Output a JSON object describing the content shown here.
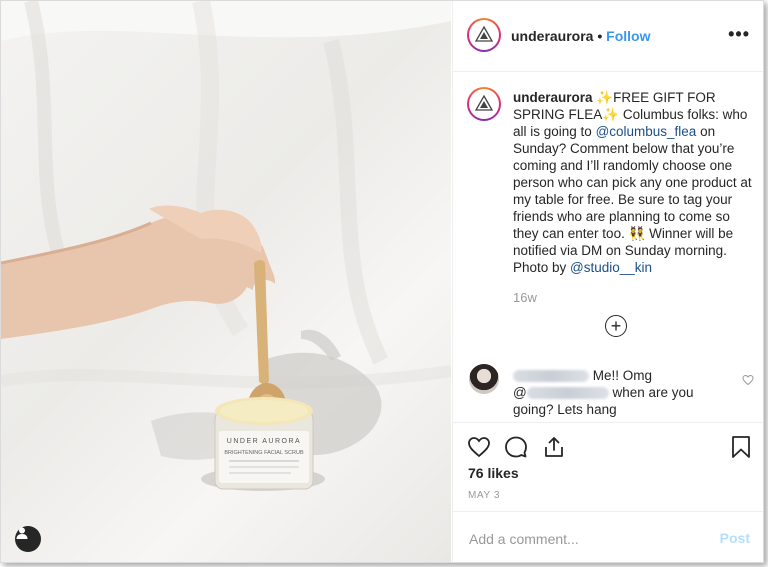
{
  "post": {
    "username": "underaurora",
    "follow_label": "Follow",
    "more_label": "•••",
    "caption_parts": {
      "lead": "✨FREE GIFT FOR SPRING FLEA✨ Columbus folks: who all is going to ",
      "mention1": "@columbus_flea",
      "middle": " on Sunday? Comment below that you’re coming and I’ll randomly choose one person who can pick any one product at my table for free. Be sure to tag your friends who are planning to come so they can enter too. 👯 Winner will be notified via DM on Sunday morning. Photo by ",
      "mention2": "@studio__kin"
    },
    "age": "16w",
    "likes": "76 likes",
    "date": "MAY 3"
  },
  "comment": {
    "text_part1": "Me!! Omg",
    "at_symbol": "@",
    "text_part2": "when are you going? Lets hang"
  },
  "comment_box": {
    "placeholder": "Add a comment...",
    "post_label": "Post"
  },
  "photo": {
    "jar_brand": "UNDER AURORA",
    "jar_product": "BRIGHTENING FACIAL SCRUB"
  },
  "colors": {
    "link": "#3897f0",
    "mention": "#1b4f8a",
    "muted": "#999999",
    "post_disabled": "#b2dffc"
  },
  "icons": [
    "heart-icon",
    "comment-icon",
    "share-icon",
    "bookmark-icon",
    "add-circle-icon",
    "user-tag-icon",
    "more-icon"
  ]
}
